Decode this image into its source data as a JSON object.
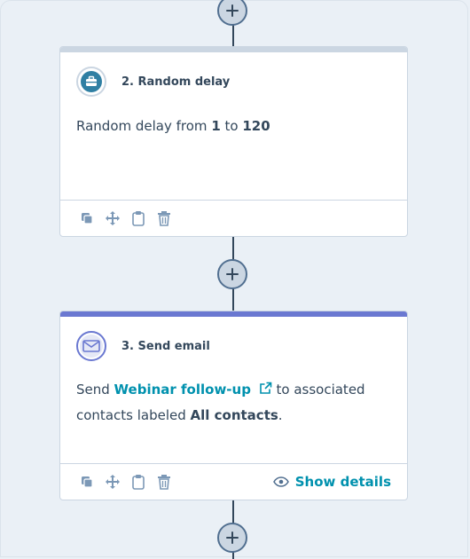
{
  "colors": {
    "canvas": "#eaf0f6",
    "delay_bar": "#cbd6e2",
    "email_bar": "#6a78d1",
    "link": "#0091ae",
    "text": "#33475b"
  },
  "steps": [
    {
      "title": "2. Random delay",
      "icon": "briefcase-icon",
      "body": {
        "prefix": "Random delay from ",
        "from": "1",
        "middle": " to ",
        "to": "120"
      },
      "footer_icons": [
        "copy-icon",
        "move-icon",
        "clipboard-icon",
        "trash-icon"
      ]
    },
    {
      "title": "3. Send email",
      "icon": "envelope-icon",
      "body": {
        "prefix": "Send ",
        "email_name": "Webinar follow-up",
        "middle": " to associated",
        "line2_prefix": "contacts labeled ",
        "label": "All contacts",
        "suffix": "."
      },
      "footer_icons": [
        "copy-icon",
        "move-icon",
        "clipboard-icon",
        "trash-icon"
      ],
      "show_details_label": "Show details"
    }
  ]
}
